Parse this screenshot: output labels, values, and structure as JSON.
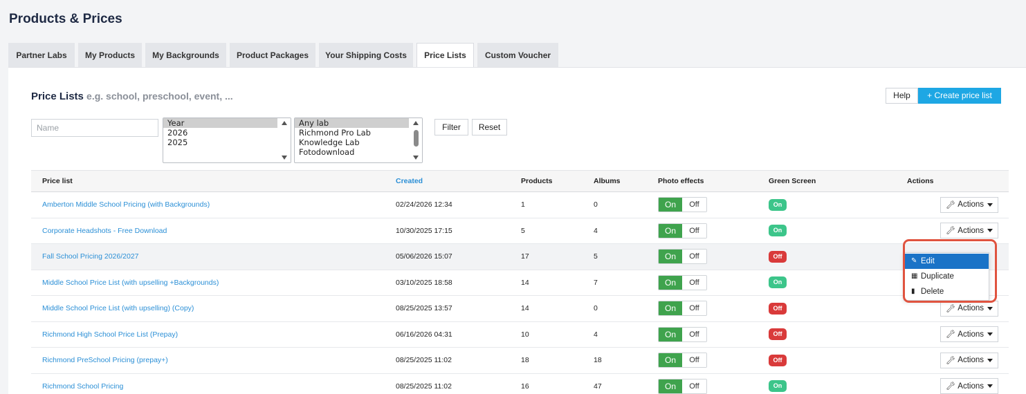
{
  "page_title": "Products & Prices",
  "tabs": [
    {
      "label": "Partner Labs"
    },
    {
      "label": "My Products"
    },
    {
      "label": "My Backgrounds"
    },
    {
      "label": "Product Packages"
    },
    {
      "label": "Your Shipping Costs"
    },
    {
      "label": "Price Lists",
      "active": true
    },
    {
      "label": "Custom Voucher"
    }
  ],
  "section": {
    "title": "Price Lists",
    "hint": "e.g. school, preschool, event, ...",
    "help_label": "Help",
    "create_label": "+ Create price list"
  },
  "filters": {
    "name_placeholder": "Name",
    "year_options": [
      "Year",
      "2026",
      "2025"
    ],
    "lab_options": [
      "Any lab",
      "Richmond Pro Lab",
      "Knowledge Lab",
      "Fotodownload"
    ],
    "filter_label": "Filter",
    "reset_label": "Reset"
  },
  "table": {
    "headers": {
      "price_list": "Price list",
      "created": "Created",
      "products": "Products",
      "albums": "Albums",
      "photo_effects": "Photo effects",
      "green_screen": "Green Screen",
      "actions": "Actions"
    },
    "rows": [
      {
        "name": "Amberton Middle School Pricing (with Backgrounds)",
        "created": "02/24/2026 12:34",
        "products": "1",
        "albums": "0",
        "fx_on": "On",
        "fx_off": "Off",
        "green": "On"
      },
      {
        "name": "Corporate Headshots - Free Download",
        "created": "10/30/2025 17:15",
        "products": "5",
        "albums": "4",
        "fx_on": "On",
        "fx_off": "Off",
        "green": "On"
      },
      {
        "name": "Fall School Pricing 2026/2027",
        "created": "05/06/2026 15:07",
        "products": "17",
        "albums": "5",
        "fx_on": "On",
        "fx_off": "Off",
        "green": "Off"
      },
      {
        "name": "Middle School Price List (with upselling +Backgrounds)",
        "created": "03/10/2025 18:58",
        "products": "14",
        "albums": "7",
        "fx_on": "On",
        "fx_off": "Off",
        "green": "On"
      },
      {
        "name": "Middle School Price List (with upselling) (Copy)",
        "created": "08/25/2025 13:57",
        "products": "14",
        "albums": "0",
        "fx_on": "On",
        "fx_off": "Off",
        "green": "Off"
      },
      {
        "name": "Richmond High School Price List (Prepay)",
        "created": "06/16/2026 04:31",
        "products": "10",
        "albums": "4",
        "fx_on": "On",
        "fx_off": "Off",
        "green": "Off"
      },
      {
        "name": "Richmond PreSchool Pricing (prepay+)",
        "created": "08/25/2025 11:02",
        "products": "18",
        "albums": "18",
        "fx_on": "On",
        "fx_off": "Off",
        "green": "Off"
      },
      {
        "name": "Richmond School Pricing",
        "created": "08/25/2025 11:02",
        "products": "16",
        "albums": "47",
        "fx_on": "On",
        "fx_off": "Off",
        "green": "On"
      }
    ],
    "actions_label": "Actions"
  },
  "dropdown": {
    "items": [
      {
        "label": "Edit",
        "icon": "pencil-icon"
      },
      {
        "label": "Duplicate",
        "icon": "table-icon"
      },
      {
        "label": "Delete",
        "icon": "trash-icon"
      }
    ]
  },
  "colors": {
    "accent": "#1ea7e4",
    "link": "#2b8fd6",
    "toggle_on": "#3fa34d",
    "pill_on": "#3cc58a",
    "pill_off": "#d93a3a",
    "highlight": "#e0533f",
    "menu_active": "#1a73c7"
  }
}
